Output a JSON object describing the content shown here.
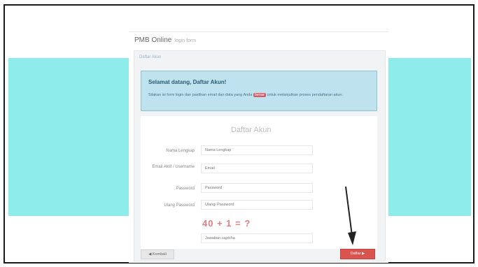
{
  "brand": {
    "name": "PMB Online",
    "tagline": "login form"
  },
  "breadcrumb": "Daftar Akun",
  "alert": {
    "title": "Selamat datang, Daftar Akun!",
    "text_before": "Silakan isi form login dan pastikan email dan data yang Anda",
    "highlight": "benar",
    "text_after": "untuk melanjutkan proses pendaftaran akun."
  },
  "form": {
    "title": "Daftar Akun",
    "fields": [
      {
        "label": "Nama Lengkap",
        "placeholder": "Nama Lengkap"
      },
      {
        "label": "Email Aktif / Username",
        "placeholder": "Email"
      },
      {
        "label": "Password",
        "placeholder": "Password"
      },
      {
        "label": "Ulang Password",
        "placeholder": "Ulangi Password"
      }
    ],
    "captcha": "40 + 1 = ?",
    "captcha_placeholder": "Jawaban captcha"
  },
  "buttons": {
    "back": "◀ Kembali",
    "submit": "Daftar ▶"
  },
  "colors": {
    "cyan_band": "#8eeceb",
    "alert_bg": "#bfe3ee",
    "submit": "#d9534f",
    "captcha": "#e07e86"
  }
}
